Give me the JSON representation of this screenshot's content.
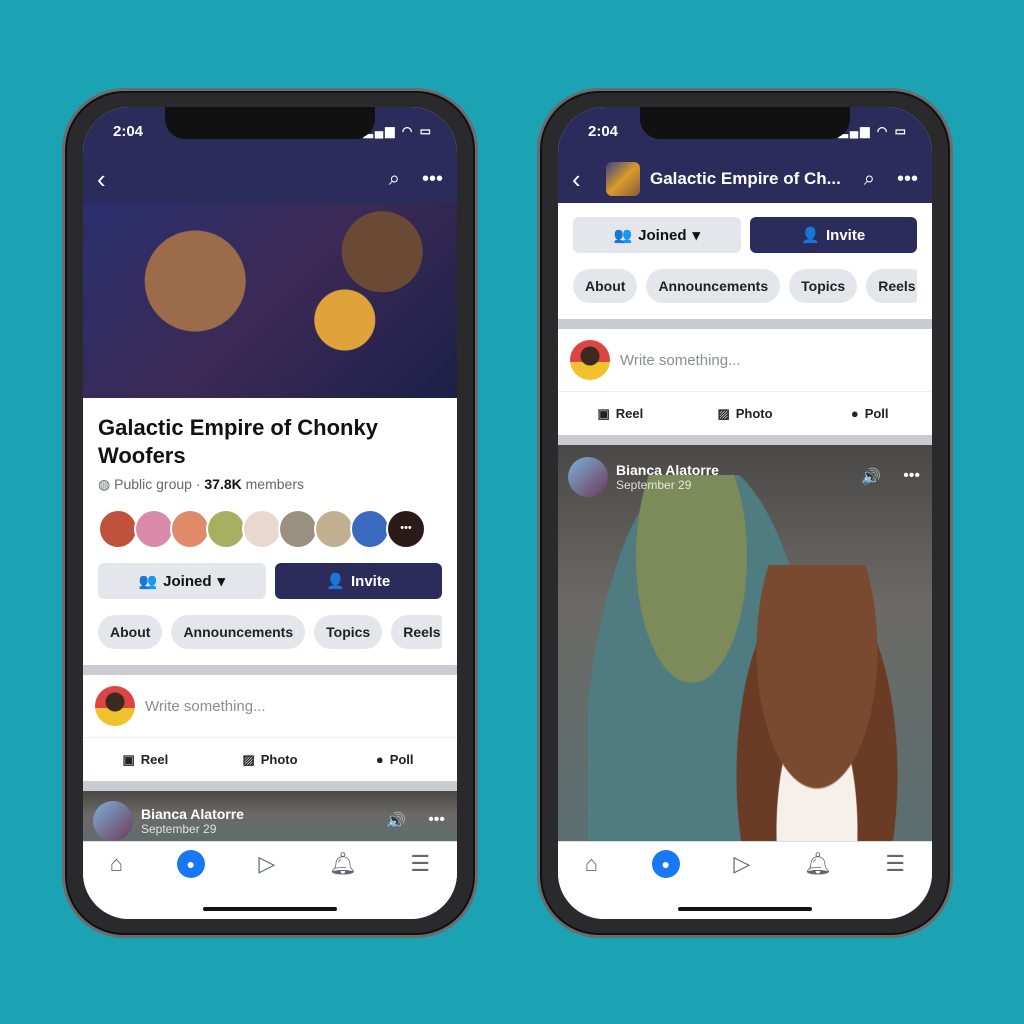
{
  "status": {
    "time": "2:04",
    "icons": "signal wifi battery"
  },
  "group": {
    "title": "Galactic Empire of Chonky Woofers",
    "title_short": "Galactic Empire of Ch...",
    "privacy": "Public group",
    "members_count": "37.8K",
    "members_label": "members"
  },
  "buttons": {
    "joined": "Joined",
    "invite": "Invite"
  },
  "tabs": [
    "About",
    "Announcements",
    "Topics",
    "Reels"
  ],
  "composer": {
    "placeholder": "Write something...",
    "actions": [
      "Reel",
      "Photo",
      "Poll"
    ]
  },
  "post": {
    "author": "Bianca Alatorre",
    "date": "September 29"
  },
  "colors": {
    "background": "#1ba3b3",
    "header": "#2b2c5c",
    "accent": "#1877f2"
  },
  "bottom_nav": [
    "home-icon",
    "groups-icon",
    "video-icon",
    "bell-icon",
    "menu-icon"
  ]
}
